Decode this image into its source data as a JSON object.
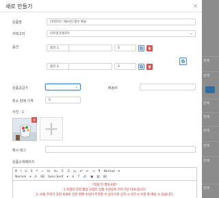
{
  "background": {
    "rows": [
      "판매",
      "판매",
      "판매",
      "판매",
      "판매",
      "판매",
      "판매",
      "판매"
    ]
  },
  "modal": {
    "title": "새로 만들기",
    "close": "×",
    "fields": {
      "product_name": {
        "label": "상품명",
        "value": "[프라이드 에뉴된] 청수 메뉴"
      },
      "category": {
        "label": "카테고리",
        "value": "이프엔크레프트"
      },
      "options": {
        "label": "옵션",
        "row1": {
          "name": "옵션 1",
          "price": "0"
        },
        "row2": {
          "name": "옵션 2",
          "price": "0"
        }
      },
      "supply_price": {
        "label": "상품공급가",
        "value": ""
      },
      "shipping": {
        "label": "배송비",
        "value": ""
      },
      "min_order": {
        "label": "최소 판매 가격",
        "value": "0"
      },
      "photos": {
        "label": "사진 · 1"
      },
      "hashtag": {
        "label": "해시 태그",
        "value": ""
      },
      "description": {
        "label": "상품소개페이지"
      }
    },
    "editor": {
      "toolbar_row1": [
        "B",
        "I",
        "U",
        "S",
        "❝",
        "‹›",
        "H₁",
        "H₂",
        "☰",
        "☰",
        "x₂",
        "x²",
        "⇤",
        "⇥",
        "¶",
        "Normal",
        "▾"
      ],
      "toolbar_row2": [
        "Normal",
        "▾",
        "A",
        "⌫",
        "Sans Serif",
        "▾",
        "≡",
        "T",
        "🔗",
        "▣",
        "▤",
        "⌧"
      ],
      "lines": [
        "*작성 전 필독사항*",
        "1.작성의 고정 활용 규정은 상품 수정일로 부터 7일 이내 입니다.",
        "2. 보물 주의가 고정 보류로 인한 판매 수익이 부족할 수 있으므로 공지 시 반드시 수정 후 배송 소 있습니다."
      ]
    }
  },
  "colors": {
    "delete_red": "#d9534f",
    "action_blue": "#3a6fb0",
    "notice_red": "#dd2222"
  }
}
